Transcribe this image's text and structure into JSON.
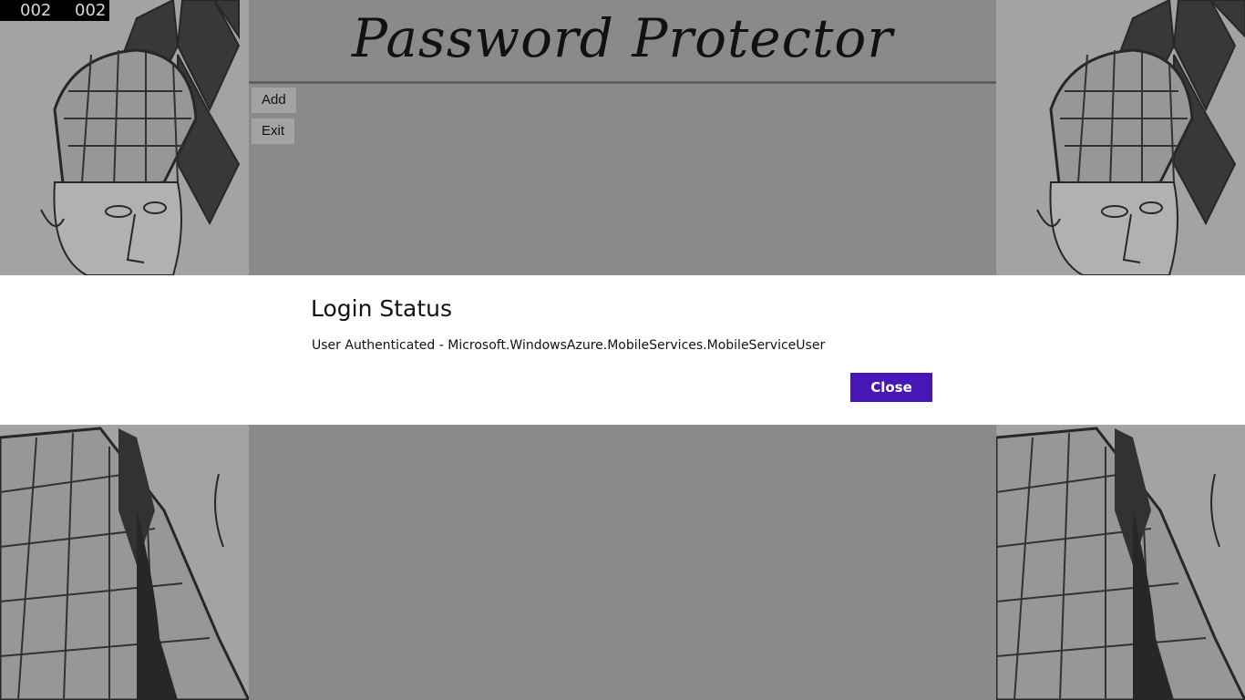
{
  "counter": {
    "left": "002",
    "right": "002"
  },
  "header": {
    "title": "Password Protector"
  },
  "toolbar": {
    "add_label": "Add",
    "exit_label": "Exit"
  },
  "dialog": {
    "title": "Login Status",
    "message": "User Authenticated - Microsoft.WindowsAzure.MobileServices.MobileServiceUser",
    "close_label": "Close"
  },
  "colors": {
    "accent": "#4617b4",
    "background": "#8a8a8a",
    "dialog_background": "#ffffff"
  },
  "decor": {
    "left_panel_image": "detective-sketch-illustration",
    "right_panel_image": "detective-sketch-illustration"
  }
}
